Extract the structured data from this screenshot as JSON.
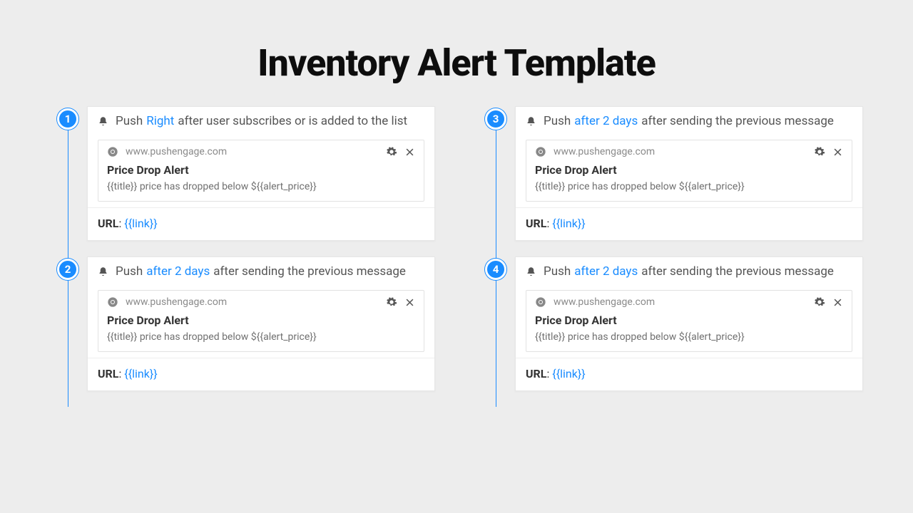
{
  "title": "Inventory Alert Template",
  "steps": [
    {
      "num": "1",
      "push_label": "Push",
      "timing": "Right",
      "trail": "after user subscribes or is added to the list",
      "domain": "www.pushengage.com",
      "notif_title": "Price Drop Alert",
      "notif_body": "{{title}} price has dropped below ${{alert_price}}",
      "url_label": "URL",
      "url_value": "{{link}}"
    },
    {
      "num": "2",
      "push_label": "Push",
      "timing": "after 2 days",
      "trail": "after sending the previous message",
      "domain": "www.pushengage.com",
      "notif_title": "Price Drop Alert",
      "notif_body": "{{title}} price has dropped below ${{alert_price}}",
      "url_label": "URL",
      "url_value": "{{link}}"
    },
    {
      "num": "3",
      "push_label": "Push",
      "timing": "after 2 days",
      "trail": "after sending the previous message",
      "domain": "www.pushengage.com",
      "notif_title": "Price Drop Alert",
      "notif_body": "{{title}} price has dropped below ${{alert_price}}",
      "url_label": "URL",
      "url_value": "{{link}}"
    },
    {
      "num": "4",
      "push_label": "Push",
      "timing": "after 2 days",
      "trail": "after sending the previous message",
      "domain": "www.pushengage.com",
      "notif_title": "Price Drop Alert",
      "notif_body": "{{title}} price has dropped below ${{alert_price}}",
      "url_label": "URL",
      "url_value": "{{link}}"
    }
  ]
}
